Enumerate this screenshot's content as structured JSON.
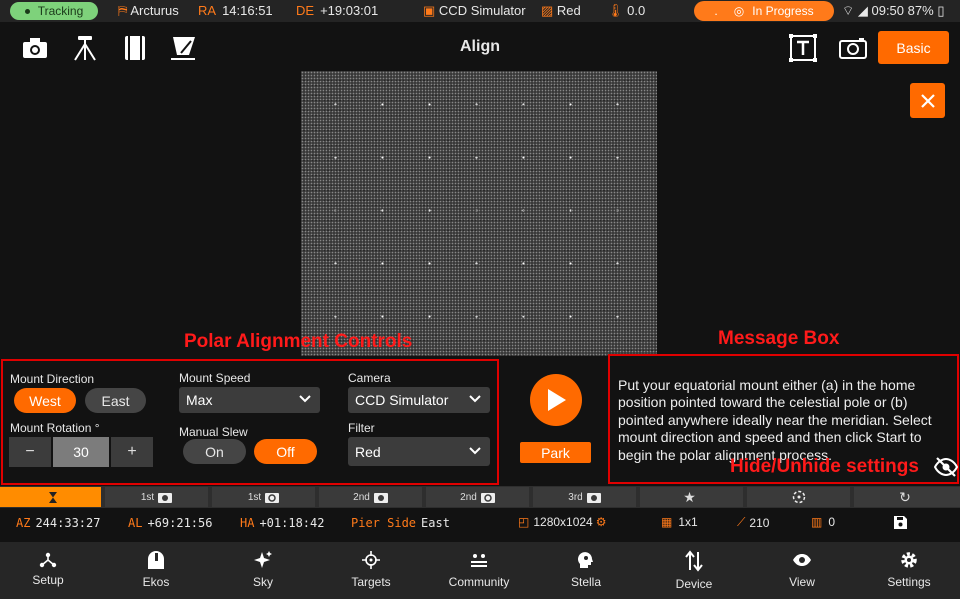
{
  "status_bar": {
    "tracking": "Tracking",
    "target": "Arcturus",
    "ra_label": "RA",
    "ra": "14:16:51",
    "de_label": "DE",
    "de": "+19:03:01",
    "camera": "CCD Simulator",
    "filter": "Red",
    "temperature": "0.0",
    "status_dot": ".",
    "progress": "In Progress",
    "clock": "09:50",
    "battery": "87%"
  },
  "toolbar": {
    "title": "Align",
    "mode_button": "Basic",
    "icons": [
      "camera-icon",
      "tripod-icon",
      "notebook-icon",
      "solver-icon",
      "text-overlay-icon",
      "image-icon"
    ]
  },
  "annotations": {
    "controls_label": "Polar Alignment Controls",
    "message_label": "Message Box",
    "hide_label": "Hide/Unhide settings"
  },
  "controls": {
    "mount_direction_label": "Mount Direction",
    "west": "West",
    "east": "East",
    "mount_direction_selected": "West",
    "mount_rotation_label": "Mount Rotation °",
    "minus": "−",
    "rotation_value": "30",
    "plus": "+",
    "mount_speed_label": "Mount Speed",
    "mount_speed": "Max",
    "manual_slew_label": "Manual Slew",
    "on": "On",
    "off": "Off",
    "manual_slew_selected": "Off",
    "camera_label": "Camera",
    "camera": "CCD Simulator",
    "filter_label": "Filter",
    "filter": "Red",
    "park": "Park"
  },
  "message": "Put your equatorial mount either (a) in the home position pointed toward the celestial pole or (b) pointed anywhere ideally near the meridian. Select mount direction and speed and then click Start to begin the polar alignment process.",
  "queue": [
    {
      "label": "",
      "icon": "hourglass-icon",
      "active": true
    },
    {
      "label": "1st",
      "icon": "camera-icon",
      "active": false
    },
    {
      "label": "1st",
      "icon": "rotate-camera-icon",
      "active": false
    },
    {
      "label": "2nd",
      "icon": "camera-icon",
      "active": false
    },
    {
      "label": "2nd",
      "icon": "rotate-camera-icon",
      "active": false
    },
    {
      "label": "3rd",
      "icon": "camera-icon",
      "active": false
    },
    {
      "label": "",
      "icon": "star-icon",
      "active": false
    },
    {
      "label": "",
      "icon": "adjust-icon",
      "active": false
    },
    {
      "label": "",
      "icon": "refresh-icon",
      "active": false
    }
  ],
  "info": {
    "az_label": "AZ",
    "az": "244:33:27",
    "al_label": "AL",
    "al": "+69:21:56",
    "ha_label": "HA",
    "ha": "+01:18:42",
    "pier_label": "Pier Side",
    "pier": "East",
    "resolution": "1280x1024",
    "binning": "1x1",
    "stat1": "210",
    "stat2": "0"
  },
  "nav": [
    "Setup",
    "Ekos",
    "Sky",
    "Targets",
    "Community",
    "Stella",
    "Device",
    "View",
    "Settings"
  ],
  "colors": {
    "accent": "#ff6a00",
    "tracking": "#7ed27b",
    "annotation": "#ff1a1a"
  }
}
